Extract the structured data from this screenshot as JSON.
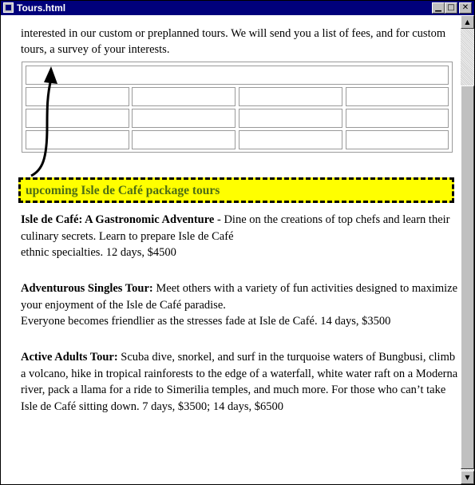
{
  "window": {
    "title": "Tours.html",
    "controls": {
      "minimize": "▁",
      "maximize": "□",
      "close": "✕"
    }
  },
  "content": {
    "intro": "interested in our custom or preplanned tours. We will send you a list of fees, and for custom tours, a survey of your interests.",
    "banner": "upcoming Isle de Café package tours",
    "tours": [
      {
        "name": "Isle de Café: A Gastronomic Adventure",
        "separator": " - ",
        "description_1": "Dine on the creations of top chefs and learn their culinary secrets. Learn to prepare Isle de Café",
        "description_2": "ethnic specialties. 12 days, $4500"
      },
      {
        "name": "Adventurous Singles Tour:",
        "separator": " ",
        "description_1": "Meet others with a variety of fun activities designed to maximize your enjoyment of the Isle de Café paradise.",
        "description_2": "Everyone becomes friendlier as the stresses fade at Isle de Café. 14 days, $3500"
      },
      {
        "name": "Active Adults Tour:",
        "separator": " ",
        "description_1": "Scuba dive, snorkel, and surf in the turquoise waters of Bungbusi, climb a volcano, hike in tropical rainforests to the edge of a waterfall, white water raft on a Moderna river, pack a llama for a ride to Simerilia temples, and much more. For those who can’t take Isle de Café sitting down. 7 days, $3500; 14 days, $6500",
        "description_2": ""
      }
    ]
  },
  "scrollbar": {
    "up_arrow": "▲",
    "down_arrow": "▼"
  },
  "colors": {
    "titlebar": "#00007b",
    "banner_background": "#ffff00",
    "banner_text": "#4d6d14"
  },
  "icons": [
    "app-icon",
    "arrow-annotation-icon"
  ]
}
